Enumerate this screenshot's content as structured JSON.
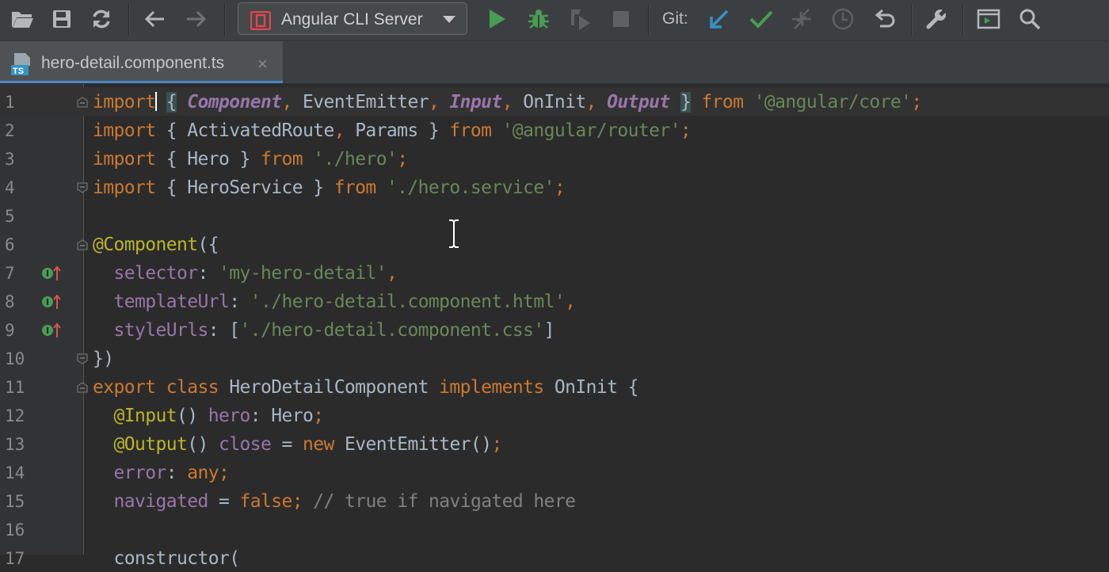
{
  "toolbar": {
    "run_config_label": "Angular CLI Server",
    "git_label": "Git:",
    "icons": [
      "open-folder-icon",
      "save-icon",
      "sync-icon",
      "back-arrow-icon",
      "forward-arrow-icon",
      "angular-icon",
      "run-icon",
      "debug-icon",
      "run-coverage-icon",
      "stop-icon",
      "git-update-icon",
      "git-commit-icon",
      "git-compare-icon",
      "git-history-icon",
      "revert-icon",
      "wrench-icon",
      "terminal-icon",
      "search-icon"
    ]
  },
  "tab": {
    "filename": "hero-detail.component.ts",
    "file_type_badge": "TS",
    "close_glyph": "×"
  },
  "editor": {
    "line_numbers": [
      "1",
      "2",
      "3",
      "4",
      "5",
      "6",
      "7",
      "8",
      "9",
      "10",
      "11",
      "12",
      "13",
      "14",
      "15",
      "16",
      "17"
    ],
    "current_line": 1,
    "lines": [
      {
        "pre": "import",
        "rest": [
          {
            "t": " ",
            "c": ""
          },
          {
            "t": "{",
            "c": "hl"
          },
          {
            "t": " ",
            "c": ""
          },
          {
            "t": "Component",
            "c": "ia"
          },
          {
            "t": ", ",
            "c": "k"
          },
          {
            "t": "EventEmitter",
            "c": ""
          },
          {
            "t": ", ",
            "c": "k"
          },
          {
            "t": "Input",
            "c": "ia"
          },
          {
            "t": ", ",
            "c": "k"
          },
          {
            "t": "OnInit",
            "c": ""
          },
          {
            "t": ", ",
            "c": "k"
          },
          {
            "t": "Output",
            "c": "ia"
          },
          {
            "t": " ",
            "c": ""
          },
          {
            "t": "}",
            "c": "hl"
          },
          {
            "t": " ",
            "c": ""
          },
          {
            "t": "from",
            "c": "k"
          },
          {
            "t": " ",
            "c": ""
          },
          {
            "t": "'@angular/core'",
            "c": "s"
          },
          {
            "t": ";",
            "c": "k"
          }
        ]
      },
      {
        "rest": [
          {
            "t": "import",
            "c": "k"
          },
          {
            "t": " { ActivatedRoute",
            "c": ""
          },
          {
            "t": ", ",
            "c": "k"
          },
          {
            "t": "Params } ",
            "c": ""
          },
          {
            "t": "from",
            "c": "k"
          },
          {
            "t": " ",
            "c": ""
          },
          {
            "t": "'@angular/router'",
            "c": "s"
          },
          {
            "t": ";",
            "c": "k"
          }
        ]
      },
      {
        "rest": [
          {
            "t": "import",
            "c": "k"
          },
          {
            "t": " { Hero } ",
            "c": ""
          },
          {
            "t": "from",
            "c": "k"
          },
          {
            "t": " ",
            "c": ""
          },
          {
            "t": "'./hero'",
            "c": "s"
          },
          {
            "t": ";",
            "c": "k"
          }
        ]
      },
      {
        "rest": [
          {
            "t": "import",
            "c": "k"
          },
          {
            "t": " { HeroService } ",
            "c": ""
          },
          {
            "t": "from",
            "c": "k"
          },
          {
            "t": " ",
            "c": ""
          },
          {
            "t": "'./hero.service'",
            "c": "s"
          },
          {
            "t": ";",
            "c": "k"
          }
        ]
      },
      {
        "rest": []
      },
      {
        "rest": [
          {
            "t": "@Component",
            "c": "an"
          },
          {
            "t": "({",
            "c": ""
          }
        ]
      },
      {
        "rest": [
          {
            "t": "  ",
            "c": ""
          },
          {
            "t": "selector",
            "c": "p"
          },
          {
            "t": ": ",
            "c": ""
          },
          {
            "t": "'my-hero-detail'",
            "c": "s"
          },
          {
            "t": ",",
            "c": "k"
          }
        ]
      },
      {
        "rest": [
          {
            "t": "  ",
            "c": ""
          },
          {
            "t": "templateUrl",
            "c": "p"
          },
          {
            "t": ": ",
            "c": ""
          },
          {
            "t": "'./hero-detail.component.html'",
            "c": "s"
          },
          {
            "t": ",",
            "c": "k"
          }
        ]
      },
      {
        "rest": [
          {
            "t": "  ",
            "c": ""
          },
          {
            "t": "styleUrls",
            "c": "p"
          },
          {
            "t": ": [",
            "c": ""
          },
          {
            "t": "'./hero-detail.component.css'",
            "c": "s"
          },
          {
            "t": "]",
            "c": ""
          }
        ]
      },
      {
        "rest": [
          {
            "t": "})",
            "c": ""
          }
        ]
      },
      {
        "rest": [
          {
            "t": "export class ",
            "c": "k"
          },
          {
            "t": "HeroDetailComponent ",
            "c": ""
          },
          {
            "t": "implements ",
            "c": "k"
          },
          {
            "t": "OnInit {",
            "c": ""
          }
        ]
      },
      {
        "rest": [
          {
            "t": "  ",
            "c": ""
          },
          {
            "t": "@Input",
            "c": "an"
          },
          {
            "t": "() ",
            "c": ""
          },
          {
            "t": "hero",
            "c": "p"
          },
          {
            "t": ": Hero",
            "c": ""
          },
          {
            "t": ";",
            "c": "k"
          }
        ]
      },
      {
        "rest": [
          {
            "t": "  ",
            "c": ""
          },
          {
            "t": "@Output",
            "c": "an"
          },
          {
            "t": "() ",
            "c": ""
          },
          {
            "t": "close",
            "c": "p"
          },
          {
            "t": " = ",
            "c": ""
          },
          {
            "t": "new ",
            "c": "k"
          },
          {
            "t": "EventEmitter()",
            "c": ""
          },
          {
            "t": ";",
            "c": "k"
          }
        ]
      },
      {
        "rest": [
          {
            "t": "  ",
            "c": ""
          },
          {
            "t": "error",
            "c": "p"
          },
          {
            "t": ": ",
            "c": ""
          },
          {
            "t": "any",
            "c": "k"
          },
          {
            "t": ";",
            "c": "k"
          }
        ]
      },
      {
        "rest": [
          {
            "t": "  ",
            "c": ""
          },
          {
            "t": "navigated",
            "c": "p"
          },
          {
            "t": " = ",
            "c": ""
          },
          {
            "t": "false",
            "c": "k"
          },
          {
            "t": "; ",
            "c": "k"
          },
          {
            "t": "// true if navigated here",
            "c": "c"
          }
        ]
      },
      {
        "rest": []
      },
      {
        "rest": [
          {
            "t": "  ",
            "c": ""
          },
          {
            "t": "constructor(",
            "c": ""
          }
        ]
      }
    ]
  },
  "colors": {
    "background": "#2b2b2b",
    "toolbar": "#3c3f41",
    "tab_active": "#4e5254",
    "tab_underline": "#4a88c7",
    "keyword": "#cc7832",
    "string": "#6a8759",
    "property": "#9876aa",
    "annotation": "#bbb529",
    "comment": "#808080"
  }
}
